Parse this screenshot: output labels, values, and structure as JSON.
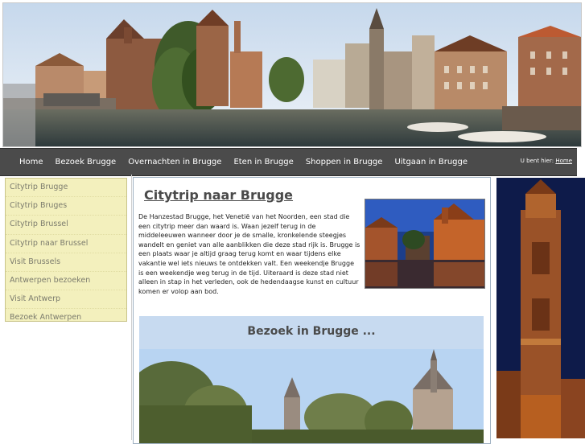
{
  "nav": {
    "items": [
      "Home",
      "Bezoek Brugge",
      "Overnachten in Brugge",
      "Eten in Brugge",
      "Shoppen in Brugge",
      "Uitgaan in Brugge"
    ],
    "breadcrumb_prefix": "U bent hier:",
    "breadcrumb_link": "Home"
  },
  "sidebar": {
    "items": [
      "Citytrip Brugge",
      "Citytrip Bruges",
      "Citytrip Brussel",
      "Citytrip naar Brussel",
      "Visit Brussels",
      "Antwerpen bezoeken",
      "Visit Antwerp",
      "Bezoek Antwerpen"
    ]
  },
  "main": {
    "title": "Citytrip naar Brugge",
    "intro": "De Hanzestad Brugge, het Venetië van het Noorden, een stad die een citytrip meer dan waard is. Waan jezelf terug in de middeleeuwen wanneer door je de smalle, kronkelende steegjes wandelt en geniet van alle aanblikken die deze stad rijk is. Brugge is een plaats waar je altijd graag terug komt en waar tijdens elke vakantie wel iets nieuws te ontdekken valt. Een weekendje Brugge is een weekendje weg terug in de tijd. Uiteraard is deze stad niet alleen in stap in het verleden, ook de hedendaagse kunst en cultuur komen er volop aan bod.",
    "section_heading": "Bezoek in Brugge ..."
  },
  "colors": {
    "nav_bg": "#4b4b4b",
    "sidebar_bg": "#f3f0bd",
    "section_bg": "#c7daf0"
  }
}
